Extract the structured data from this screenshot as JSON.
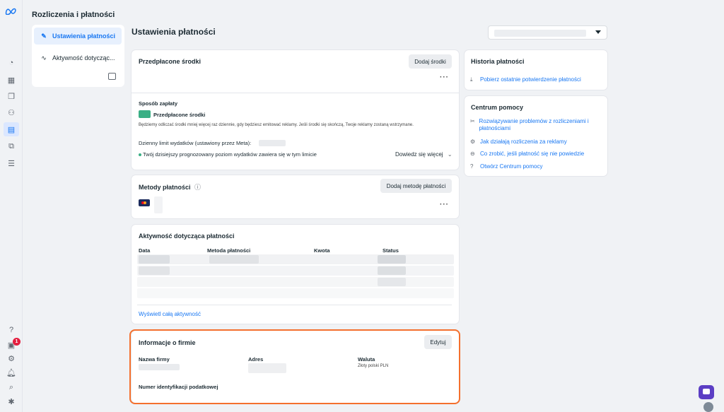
{
  "app": {
    "title": "Rozliczenia i płatności"
  },
  "nav": {
    "items": [
      {
        "label": "Ustawienia płatności",
        "icon": "pencil-icon",
        "active": true
      },
      {
        "label": "Aktywność dotycząc...",
        "icon": "activity-icon",
        "active": false
      }
    ]
  },
  "rail": {
    "badge_count": "1",
    "logo": "meta-logo"
  },
  "main": {
    "title": "Ustawienia płatności"
  },
  "prepaid": {
    "title": "Przedpłacone środki",
    "add_button": "Dodaj środki",
    "payment_method_label": "Sposób zapłaty",
    "method_name": "Przedpłacone środki",
    "description": "Będziemy odliczać środki mniej więcej raz dziennie, gdy będziesz emitować reklamy. Jeśli środki się skończą, Twoje reklamy zostaną wstrzymane.",
    "daily_limit_label": "Dzienny limit wydatków (ustawiony przez Meta):",
    "forecast_text": "Twój dzisiejszy prognozowany poziom wydatków zawiera się w tym limicie",
    "learn_more": "Dowiedz się więcej"
  },
  "methods": {
    "title": "Metody płatności",
    "add_button": "Dodaj metodę płatności"
  },
  "activity": {
    "title": "Aktywność dotycząca płatności",
    "columns": [
      "Data",
      "Metoda płatności",
      "Kwota",
      "Status"
    ],
    "view_all": "Wyświetl całą aktywność"
  },
  "business": {
    "title": "Informacje o firmie",
    "edit_button": "Edytuj",
    "name_label": "Nazwa firmy",
    "address_label": "Adres",
    "currency_label": "Waluta",
    "currency_value": "Złoty polski PLN",
    "tax_label": "Numer identyfikacji podatkowej"
  },
  "history": {
    "title": "Historia płatności",
    "download_link": "Pobierz ostatnie potwierdzenie płatności"
  },
  "help": {
    "title": "Centrum pomocy",
    "links": [
      {
        "label": "Rozwiązywanie problemów z rozliczeniami i płatnościami",
        "icon": "tools-icon"
      },
      {
        "label": "Jak działają rozliczenia za reklamy",
        "icon": "gear-icon"
      },
      {
        "label": "Co zrobić, jeśli płatność się nie powiedzie",
        "icon": "minus-circle-icon"
      },
      {
        "label": "Otwórz Centrum pomocy",
        "icon": "help-icon"
      }
    ]
  },
  "colors": {
    "accent": "#1877f2",
    "highlight": "#f4702e",
    "card": "#ffffff",
    "bg": "#f0f2f5"
  }
}
